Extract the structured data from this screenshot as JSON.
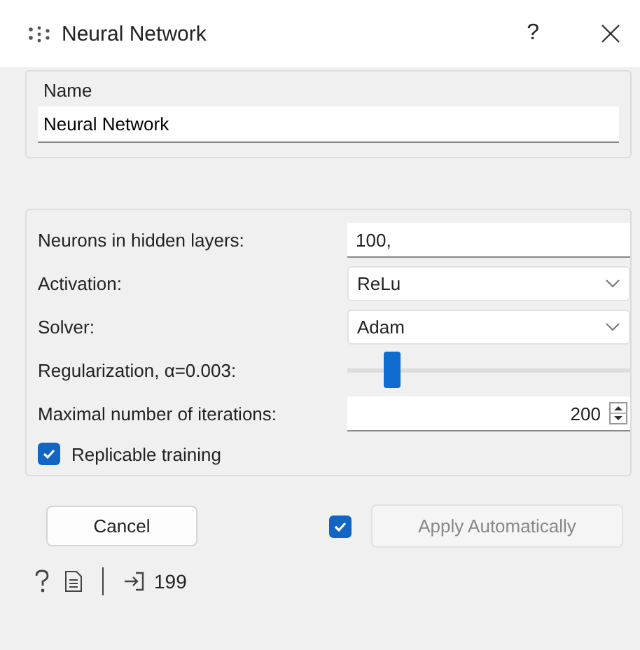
{
  "window": {
    "title": "Neural Network",
    "help": "?"
  },
  "name_box": {
    "title": "Name",
    "value": "Neural Network"
  },
  "settings": [
    {
      "kind": "text",
      "label": "Neurons in hidden layers:",
      "value": "100,"
    },
    {
      "kind": "combo",
      "label": "Activation:",
      "value": "ReLu"
    },
    {
      "kind": "combo",
      "label": "Solver:",
      "value": "Adam"
    },
    {
      "kind": "slider",
      "label": "Regularization, α=0.003:",
      "level": 0.13
    },
    {
      "kind": "spin",
      "label": "Maximal number of iterations:",
      "value": "200"
    },
    {
      "kind": "check",
      "label": "Replicable training",
      "checked": true
    }
  ],
  "footer": {
    "cancel": "Cancel",
    "auto_checked": true,
    "apply": "Apply Automatically",
    "apply_disabled": true
  },
  "status_bar": {
    "output_count": "199"
  }
}
